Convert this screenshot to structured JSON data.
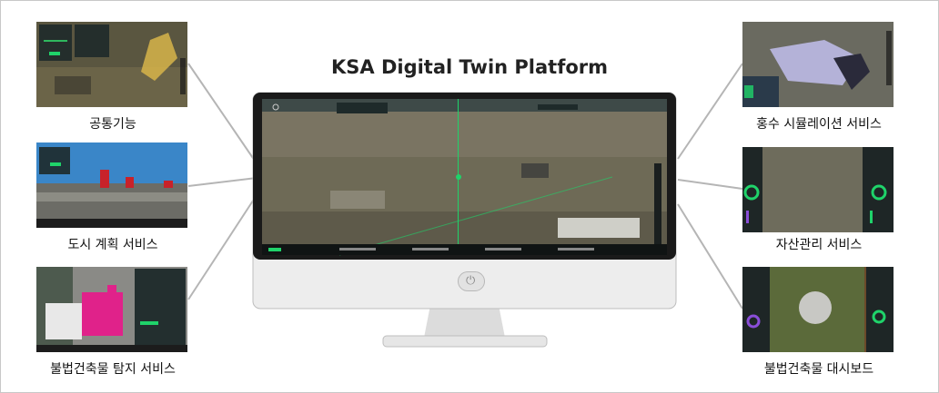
{
  "title": "KSA Digital Twin Platform",
  "services": {
    "common": "공통기능",
    "urban_planning": "도시 계획 서비스",
    "illegal_detection": "불법건축물 탐지 서비스",
    "flood_simulation": "홍수 시뮬레이션 서비스",
    "asset_management": "자산관리 서비스",
    "illegal_dashboard": "불법건축물 대시보드"
  },
  "colors": {
    "accent_green": "#1fd36a",
    "magenta_building": "#e0228a",
    "monitor_bezel": "#1a1a1a",
    "monitor_body": "#e8e8e8"
  },
  "icons": [
    "power-icon"
  ]
}
